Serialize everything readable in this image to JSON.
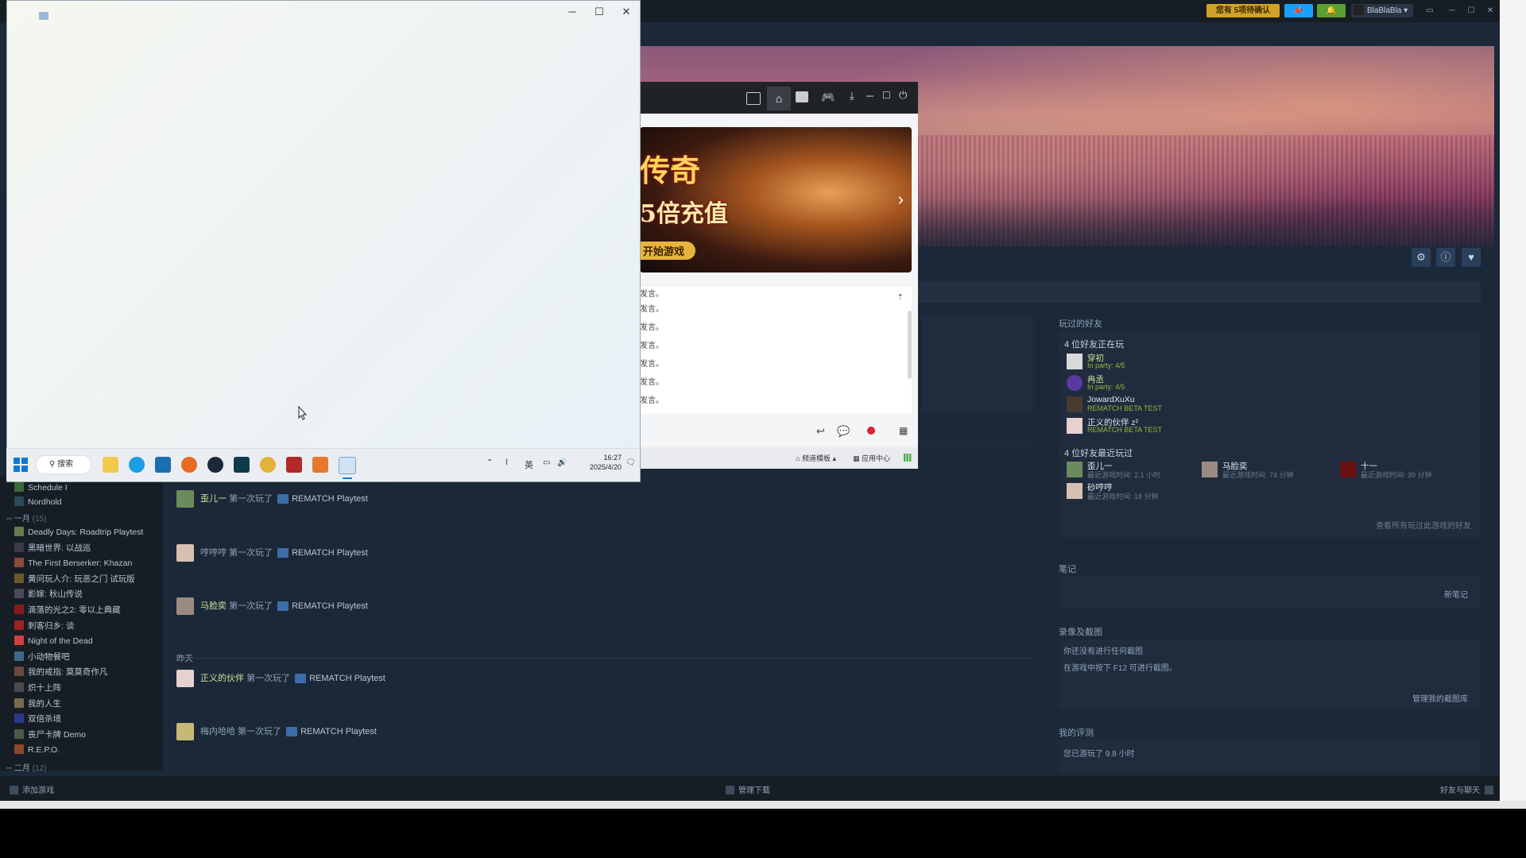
{
  "steam": {
    "titlebar": {
      "promo_label": "您有 5项待确认",
      "account_name": "BlaBlaBla",
      "account_chevron": "▾"
    },
    "hero_icons": [
      "gear-icon",
      "info-icon",
      "heart-icon"
    ],
    "friends_played": {
      "title": "玩过的好友",
      "playing_now_title": "4 位好友正在玩",
      "playing_now": [
        {
          "name": "穿初",
          "status": "In party: 4/5"
        },
        {
          "name": "冉丞",
          "status": "In party: 4/5"
        },
        {
          "name": "JowardXuXu",
          "status": "REMATCH BETA TEST"
        },
        {
          "name": "正义的伙伴 z²",
          "status": "REMATCH BETA TEST"
        }
      ],
      "played_recently_title": "4 位好友最近玩过",
      "played_recently": [
        {
          "name": "歪儿一",
          "status": "最近游戏时间: 2.1 小时"
        },
        {
          "name": "马脸奕",
          "status": "最近游戏时间: 74 分钟"
        },
        {
          "name": "十一",
          "status": "最近游戏时间: 39 分钟"
        },
        {
          "name": "砂哼哼",
          "status": "最近游戏时间: 18 分钟"
        }
      ],
      "view_all": "查看所有玩过此游戏的好友"
    },
    "notes": {
      "title": "笔记",
      "new_note": "新笔记"
    },
    "screenshots": {
      "title": "录像及截图",
      "line1": "你还没有进行任何截图",
      "line2": "在游戏中按下 F12 可进行截图。",
      "view_link": "管理我的截图库"
    },
    "review": {
      "title": "我的评测",
      "line": "您已游玩了 9.8 小时"
    },
    "library": {
      "items_top": [
        {
          "name": "Schedule I"
        },
        {
          "name": "Nordhold"
        }
      ],
      "group_jan": "一月",
      "group_jan_count": "(15)",
      "items_jan": [
        {
          "name": "Deadly Days: Roadtrip Playtest"
        },
        {
          "name": "黑暗世界: 以战巡"
        },
        {
          "name": "The First Berserker: Khazan"
        },
        {
          "name": "黄问玩人介: 玩恶之门 试玩版"
        },
        {
          "name": "影嫁: 秋山传说"
        },
        {
          "name": "滴落的光之2: 零以上典藏"
        },
        {
          "name": "刺客归乡: 谈"
        },
        {
          "name": "Night of the Dead"
        },
        {
          "name": "小动物餐吧"
        },
        {
          "name": "我的戒指: 莫莫奇作凡"
        },
        {
          "name": "炽十上阵"
        },
        {
          "name": "我的人生"
        },
        {
          "name": "双倍杀境"
        },
        {
          "name": "丧尸卡牌 Demo"
        },
        {
          "name": "R.E.P.O."
        }
      ],
      "group_feb": "二月",
      "group_feb_count": "(12)"
    },
    "activity": {
      "rows_today": [
        {
          "name": "歪儿一",
          "verb": "第一次玩了",
          "game": "REMATCH Playtest"
        },
        {
          "name": "哼哼哼 第",
          "verb": "一次玩了",
          "game": "REMATCH Playtest"
        },
        {
          "name": "马脸奕",
          "verb": "第一次玩了",
          "game": "REMATCH Playtest"
        }
      ],
      "yesterday_label": "昨天",
      "rows_yesterday": [
        {
          "name": "正义的伙伴",
          "verb": "第一次玩了",
          "game": "REMATCH Playtest"
        },
        {
          "name": "梅内哈哈 第",
          "verb": "一次玩了",
          "game": "REMATCH Playtest"
        }
      ]
    },
    "statusbar": {
      "add_game": "添加游戏",
      "downloads": "管理下载",
      "friends_chat": "好友与聊天"
    }
  },
  "launcher": {
    "banner_text_top": "传奇",
    "banner_text_mid": "5倍充值",
    "banner_text_btn": "开始游戏",
    "chat_lines": [
      "发言。",
      "发言。",
      "发言。",
      "发言。",
      "发言。",
      "发言。",
      "发言。"
    ],
    "footer_mode": "频道模板",
    "footer_center": "应用中心"
  },
  "taskbar": {
    "search_label": "搜索",
    "lang": "英",
    "time": "16:27",
    "date": "2025/4/20"
  },
  "colors": {
    "steam_bg": "#1b2838",
    "friend_name_green": "#c7e59a",
    "ingame_green": "#8fb93b",
    "promo_yellow": "#d0a22a",
    "blue_button": "#1a9fff",
    "green_button": "#5c9e31"
  }
}
